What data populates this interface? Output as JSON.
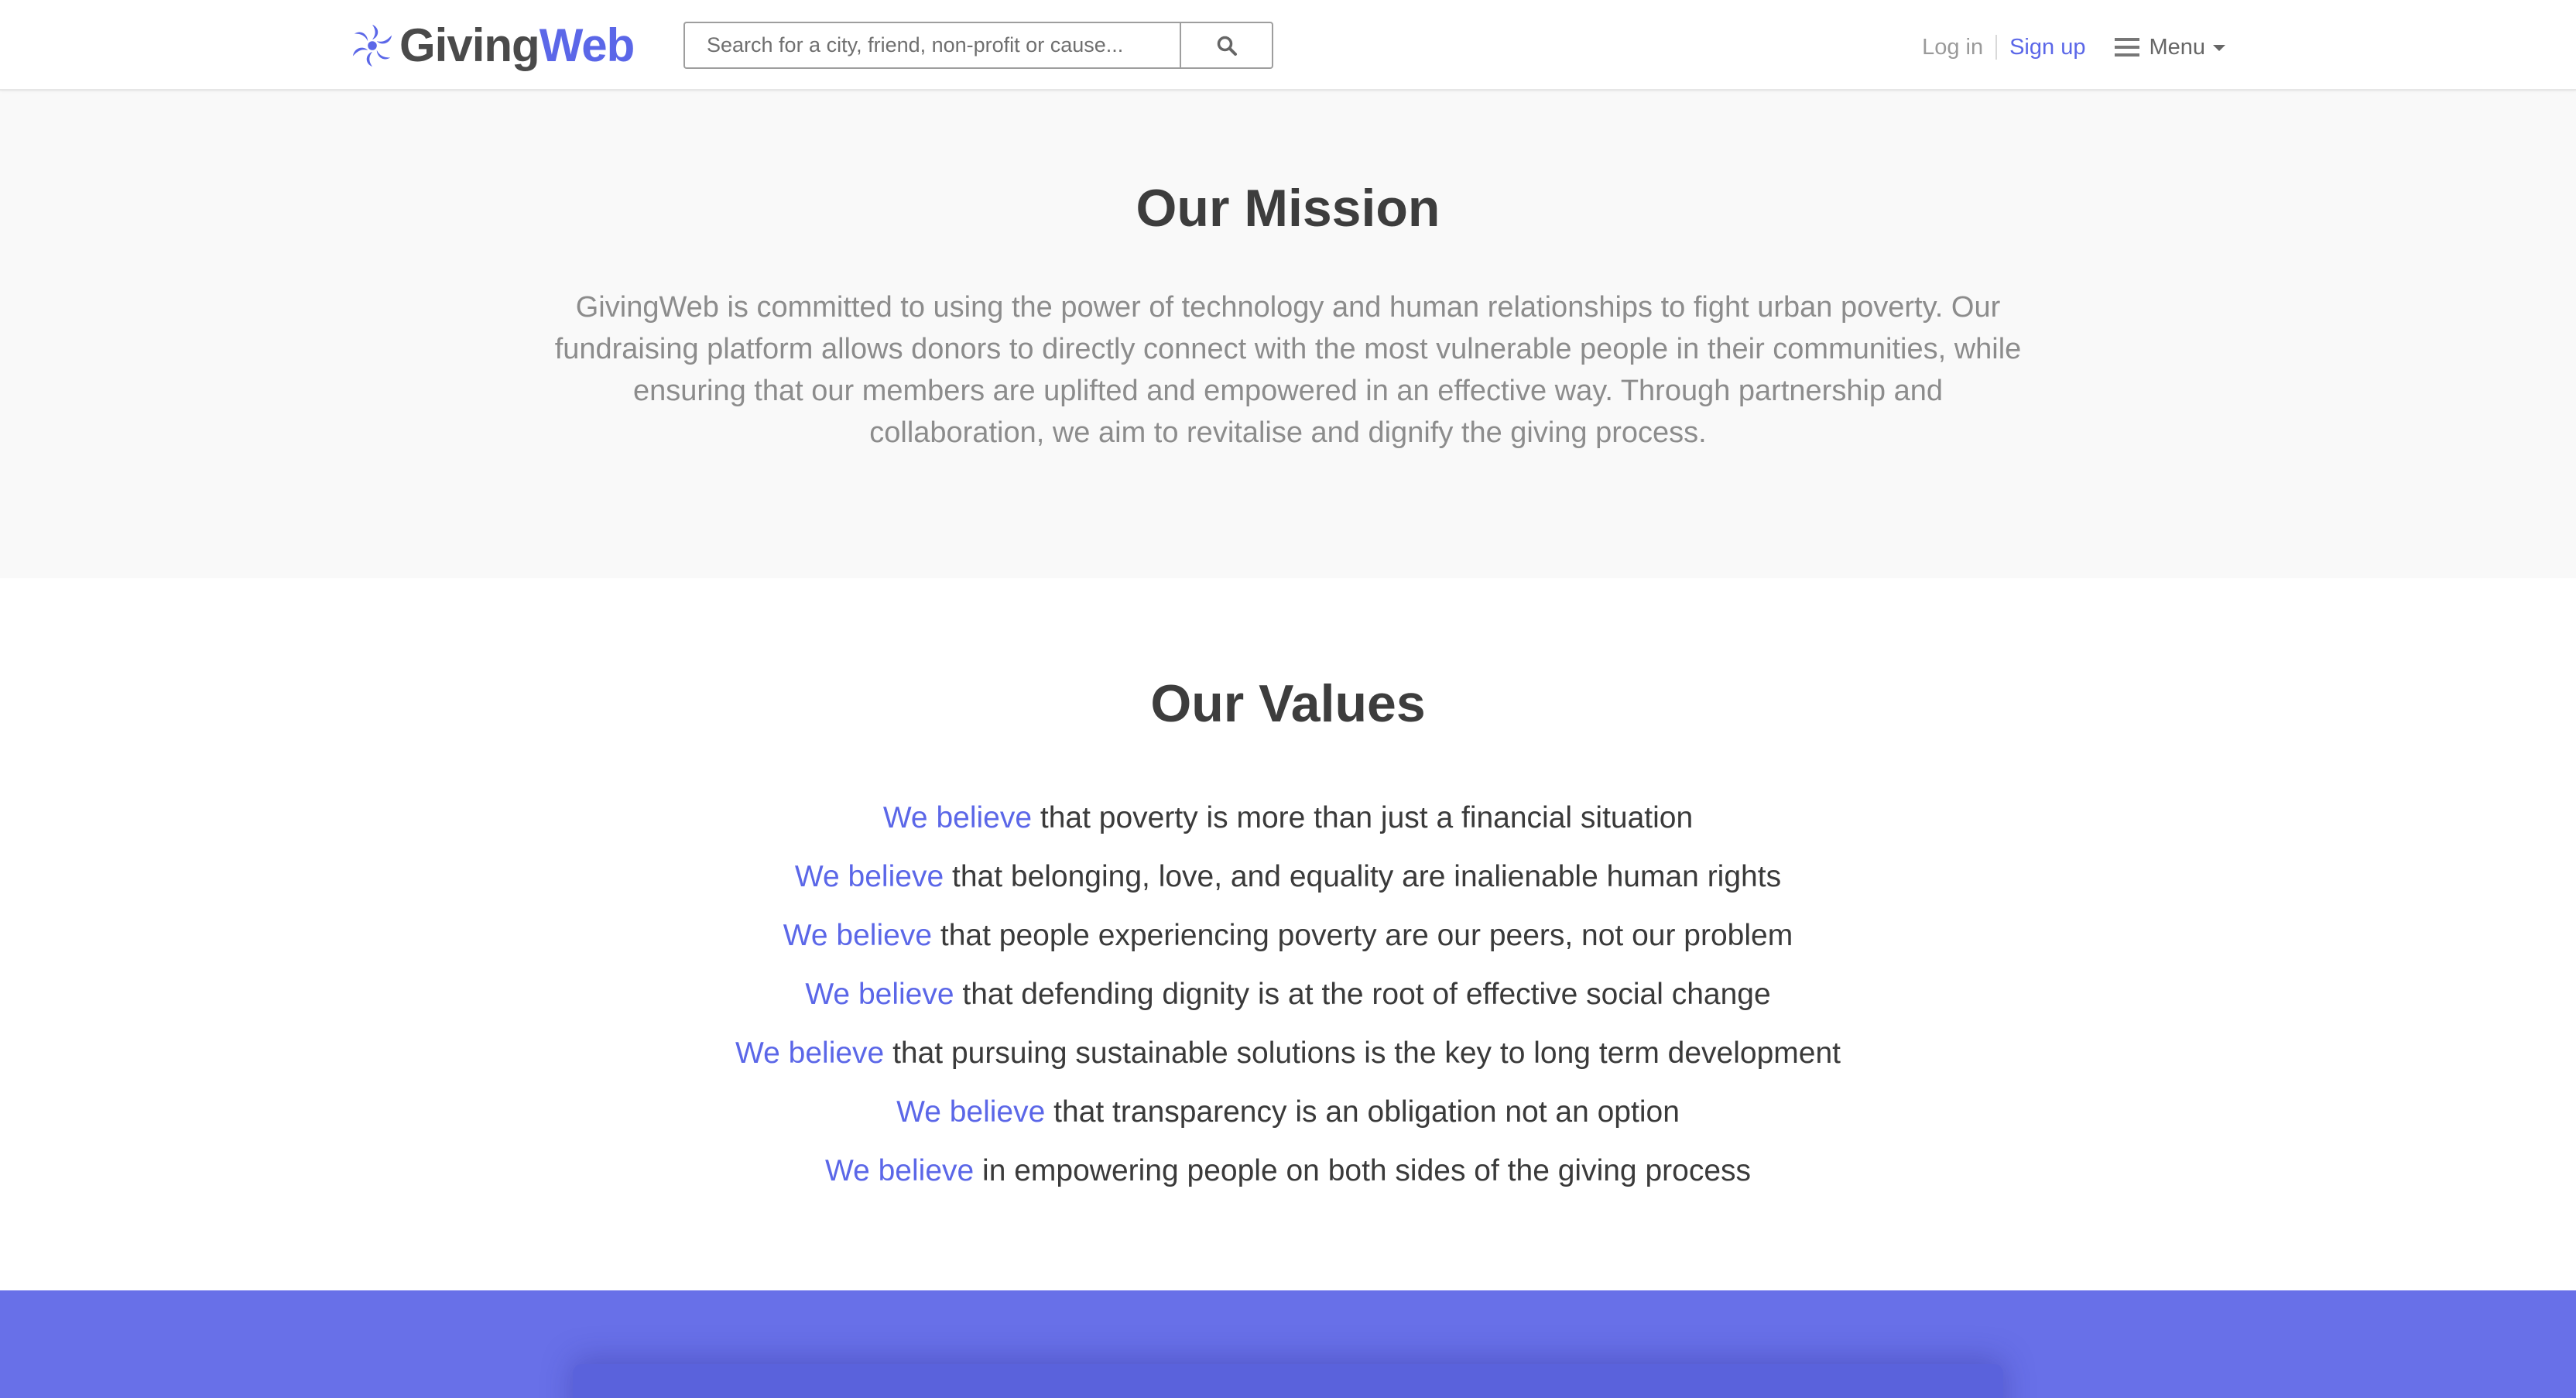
{
  "brand": {
    "name_part1": "Giving",
    "name_part2": "Web",
    "accent_color": "#5b67e8",
    "logo_icon": "flower-logo-icon"
  },
  "header": {
    "search": {
      "placeholder": "Search for a city, friend, non-profit or cause...",
      "value": "",
      "button_icon": "search-icon"
    },
    "login_label": "Log in",
    "signup_label": "Sign up",
    "menu_label": "Menu",
    "menu_icon": "hamburger-icon"
  },
  "mission": {
    "title": "Our Mission",
    "text": "GivingWeb is committed to using the power of technology and human relationships to fight urban poverty. Our fundraising platform allows donors to directly connect with the most vulnerable people in their communities, while ensuring that our members are uplifted and empowered in an effective way. Through partnership and collaboration, we aim to revitalise and dignify the giving process."
  },
  "values": {
    "title": "Our Values",
    "items": [
      {
        "lead": "We believe",
        "rest": " that poverty is more than just a financial situation"
      },
      {
        "lead": "We believe",
        "rest": " that belonging, love, and equality are inalienable human rights"
      },
      {
        "lead": "We believe",
        "rest": " that people experiencing poverty are our peers, not our problem"
      },
      {
        "lead": "We believe",
        "rest": " that defending dignity is at the root of effective social change"
      },
      {
        "lead": "We believe",
        "rest": " that pursuing sustainable solutions is the key to long term development"
      },
      {
        "lead": "We believe",
        "rest": " that transparency is an obligation not an option"
      },
      {
        "lead": "We believe",
        "rest": " in empowering people on both sides of the giving process"
      }
    ]
  },
  "colors": {
    "section_bg_light": "#f9f9f9",
    "band_purple": "#6870e8",
    "muted_text": "#8c8c8c"
  }
}
